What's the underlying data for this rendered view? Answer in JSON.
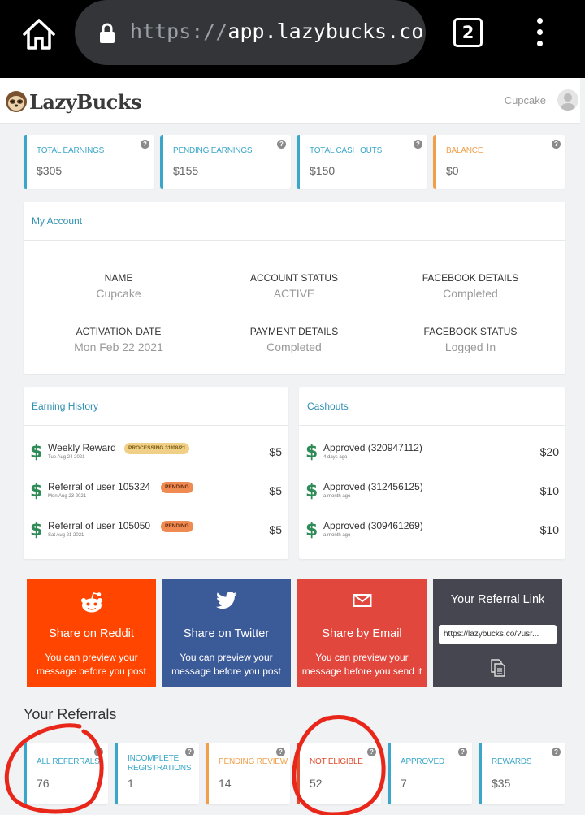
{
  "browser": {
    "url_scheme": "https://",
    "url_host": "app.lazybucks.co",
    "tab_count": "2"
  },
  "header": {
    "logo_text": "LazyBucks",
    "username": "Cupcake"
  },
  "stats": [
    {
      "label": "TOTAL EARNINGS",
      "value": "$305",
      "color": "#3aa7c9"
    },
    {
      "label": "PENDING EARNINGS",
      "value": "$155",
      "color": "#3aa7c9"
    },
    {
      "label": "TOTAL CASH OUTS",
      "value": "$150",
      "color": "#3aa7c9"
    },
    {
      "label": "BALANCE",
      "value": "$0",
      "color": "#f0a04b"
    }
  ],
  "help_glyph": "?",
  "account": {
    "title": "My Account",
    "items": [
      {
        "key": "NAME",
        "value": "Cupcake"
      },
      {
        "key": "ACCOUNT STATUS",
        "value": "ACTIVE"
      },
      {
        "key": "FACEBOOK DETAILS",
        "value": "Completed"
      },
      {
        "key": "ACTIVATION DATE",
        "value": "Mon Feb 22 2021"
      },
      {
        "key": "PAYMENT DETAILS",
        "value": "Completed"
      },
      {
        "key": "FACEBOOK STATUS",
        "value": "Logged In"
      }
    ]
  },
  "earning_history": {
    "title": "Earning History",
    "rows": [
      {
        "title": "Weekly Reward",
        "date": "Tue Aug 24 2021",
        "badge": "PROCESSING 31/08/21",
        "amount": "$5"
      },
      {
        "title": "Referral of user 105324",
        "date": "Mon Aug 23 2021",
        "badge": "PENDING",
        "amount": "$5"
      },
      {
        "title": "Referral of user 105050",
        "date": "Sat Aug 21 2021",
        "badge": "PENDING",
        "amount": "$5"
      }
    ]
  },
  "cashouts": {
    "title": "Cashouts",
    "rows": [
      {
        "title": "Approved (320947112)",
        "date": "4 days ago",
        "amount": "$20"
      },
      {
        "title": "Approved (312456125)",
        "date": "a month ago",
        "amount": "$10"
      },
      {
        "title": "Approved (309461269)",
        "date": "a month ago",
        "amount": "$10"
      }
    ]
  },
  "dollar_glyph": "$",
  "share": {
    "reddit": {
      "title": "Share on Reddit",
      "desc": "You can preview your message before you post",
      "color": "#ff4500"
    },
    "twitter": {
      "title": "Share on Twitter",
      "desc": "You can preview your message before you post",
      "color": "#3b5a98"
    },
    "email": {
      "title": "Share by Email",
      "desc": "You can preview your message before you send it",
      "color": "#e2473e"
    },
    "referral": {
      "title": "Your Referral Link",
      "link": "https://lazybucks.co/?usr..."
    }
  },
  "referrals": {
    "title": "Your Referrals",
    "items": [
      {
        "label": "ALL REFERRALS",
        "value": "76",
        "color": "#3aa7c9"
      },
      {
        "label": "INCOMPLETE REGISTRATIONS",
        "value": "1",
        "color": "#3aa7c9"
      },
      {
        "label": "PENDING REVIEW",
        "value": "14",
        "color": "#f0a04b"
      },
      {
        "label": "NOT ELIGIBLE",
        "value": "52",
        "color": "#e04b2c"
      },
      {
        "label": "APPROVED",
        "value": "7",
        "color": "#3aa7c9"
      },
      {
        "label": "REWARDS",
        "value": "$35",
        "color": "#3aa7c9"
      }
    ]
  }
}
